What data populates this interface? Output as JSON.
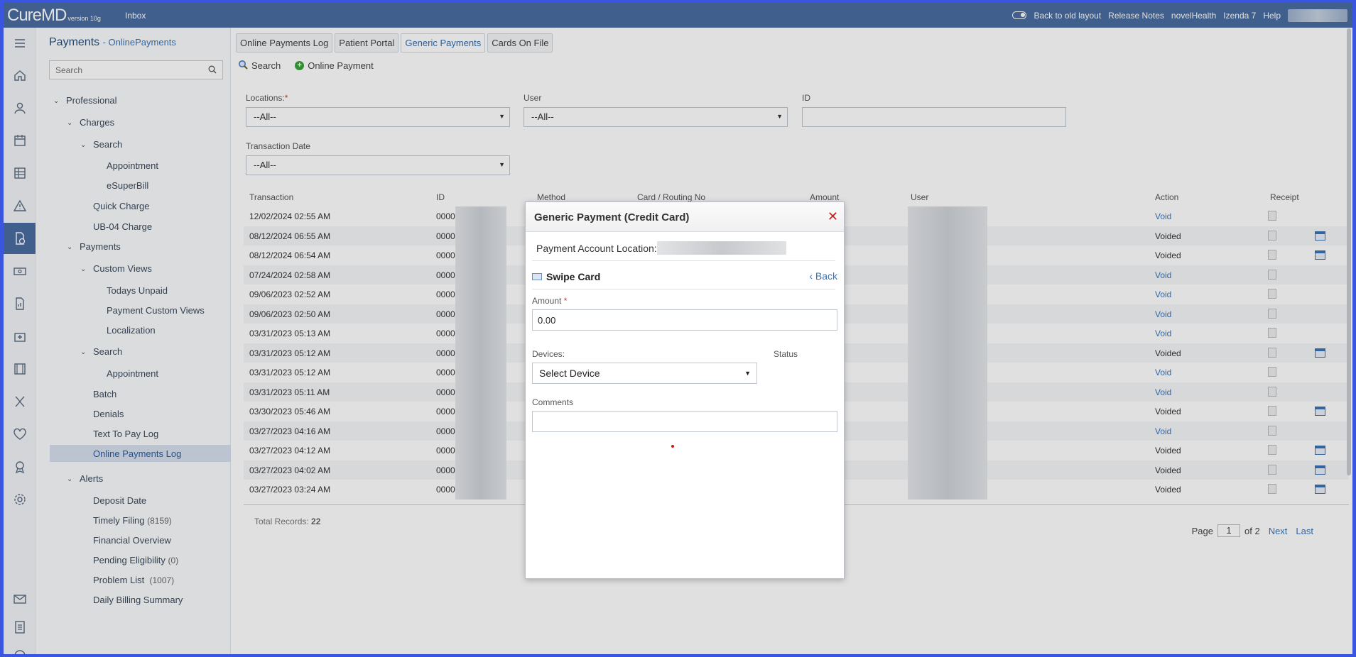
{
  "topbar": {
    "logo": "CureMD",
    "version": "version 10g",
    "inbox": "Inbox",
    "back_old_layout": "Back to old layout",
    "release_notes": "Release Notes",
    "novel_health": "novelHealth",
    "izenda": "Izenda 7",
    "help": "Help"
  },
  "nav": {
    "title": "Payments",
    "subtitle": "- OnlinePayments",
    "search_placeholder": "Search",
    "tree": {
      "professional": "Professional",
      "charges": "Charges",
      "search1": "Search",
      "appointment1": "Appointment",
      "esuperbill": "eSuperBill",
      "quick_charge": "Quick Charge",
      "ub04": "UB-04 Charge",
      "payments": "Payments",
      "custom_views": "Custom Views",
      "todays_unpaid": "Todays Unpaid",
      "payment_custom_views": "Payment Custom Views",
      "localization": "Localization",
      "search2": "Search",
      "appointment2": "Appointment",
      "batch": "Batch",
      "denials": "Denials",
      "text_to_pay": "Text To Pay Log",
      "online_payments_log": "Online Payments Log",
      "alerts": "Alerts",
      "deposit_date": "Deposit Date",
      "timely_filing": "Timely Filing",
      "timely_filing_count": "(8159)",
      "financial_overview": "Financial Overview",
      "pending_eligibility": "Pending Eligibility",
      "pending_eligibility_count": "(0)",
      "problem_list": "Problem List",
      "problem_list_count": "(1007)",
      "daily_billing": "Daily Billing Summary"
    }
  },
  "tabs": [
    "Online Payments Log",
    "Patient Portal",
    "Generic Payments",
    "Cards On File"
  ],
  "toolbar": {
    "search": "Search",
    "online_payment": "Online Payment"
  },
  "filters": {
    "locations_label": "Locations:",
    "locations_value": "--All--",
    "user_label": "User",
    "user_value": "--All--",
    "id_label": "ID",
    "txn_date_label": "Transaction Date",
    "txn_date_value": "--All--"
  },
  "table": {
    "headers": {
      "transaction": "Transaction",
      "id": "ID",
      "method": "Method",
      "card": "Card / Routing No",
      "amount": "Amount",
      "user": "User",
      "action": "Action",
      "receipt": "Receipt"
    },
    "rows": [
      {
        "transaction": "12/02/2024 02:55 AM",
        "id": "0000",
        "action": "Void"
      },
      {
        "transaction": "08/12/2024 06:55 AM",
        "id": "0000",
        "action": "Voided"
      },
      {
        "transaction": "08/12/2024 06:54 AM",
        "id": "0000",
        "action": "Voided"
      },
      {
        "transaction": "07/24/2024 02:58 AM",
        "id": "0000",
        "action": "Void"
      },
      {
        "transaction": "09/06/2023 02:52 AM",
        "id": "0000",
        "action": "Void"
      },
      {
        "transaction": "09/06/2023 02:50 AM",
        "id": "0000",
        "action": "Void"
      },
      {
        "transaction": "03/31/2023 05:13 AM",
        "id": "0000",
        "action": "Void"
      },
      {
        "transaction": "03/31/2023 05:12 AM",
        "id": "0000",
        "action": "Voided"
      },
      {
        "transaction": "03/31/2023 05:12 AM",
        "id": "0000",
        "action": "Void"
      },
      {
        "transaction": "03/31/2023 05:11 AM",
        "id": "0000",
        "action": "Void"
      },
      {
        "transaction": "03/30/2023 05:46 AM",
        "id": "0000",
        "action": "Voided"
      },
      {
        "transaction": "03/27/2023 04:16 AM",
        "id": "0000",
        "action": "Void"
      },
      {
        "transaction": "03/27/2023 04:12 AM",
        "id": "0000",
        "action": "Voided"
      },
      {
        "transaction": "03/27/2023 04:02 AM",
        "id": "0000",
        "action": "Voided"
      },
      {
        "transaction": "03/27/2023 03:24 AM",
        "id": "0000",
        "action": "Voided"
      }
    ],
    "total_label": "Total Records:",
    "total_value": "22"
  },
  "pager": {
    "page_label": "Page",
    "page_value": "1",
    "of_label": "of 2",
    "next": "Next",
    "last": "Last"
  },
  "modal": {
    "title": "Generic Payment (Credit Card)",
    "close": "✕",
    "location_label": "Payment Account Location:",
    "swipe_card": "Swipe Card",
    "back": "Back",
    "amount_label": "Amount",
    "amount_value": "0.00",
    "devices_label": "Devices:",
    "devices_value": "Select Device",
    "status_label": "Status",
    "comments_label": "Comments"
  },
  "colors": {
    "brand": "#4a6da0",
    "link": "#3a74b6",
    "close": "#d01818"
  }
}
